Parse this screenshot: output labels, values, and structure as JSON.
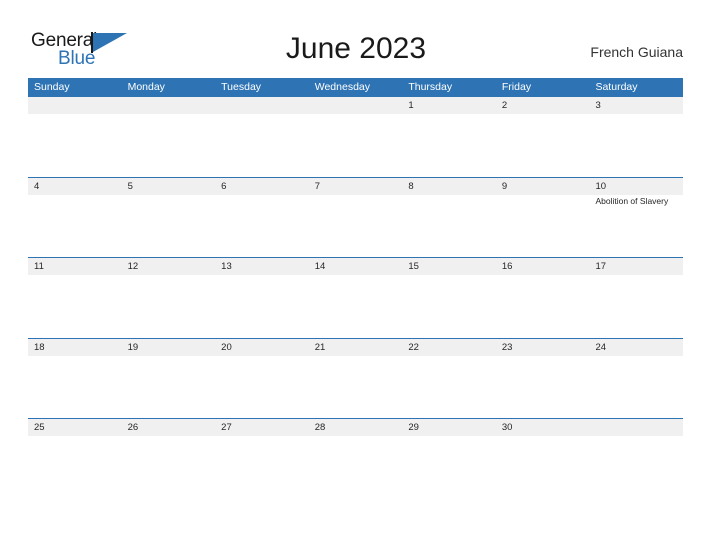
{
  "brand": {
    "name_part1": "General",
    "name_part2": "Blue",
    "flag_icon": "blue-triangle-flag-icon",
    "accent_color": "#2e74b5",
    "text_color": "#1a1a1a"
  },
  "header": {
    "title": "June 2023",
    "location": "French Guiana"
  },
  "calendar": {
    "header_color": "#2e74b5",
    "date_band_color": "#f0f0f0",
    "row_divider_color": "#2e74b5",
    "weekdays": [
      "Sunday",
      "Monday",
      "Tuesday",
      "Wednesday",
      "Thursday",
      "Friday",
      "Saturday"
    ],
    "weeks": [
      {
        "days": [
          {
            "number": "",
            "event": ""
          },
          {
            "number": "",
            "event": ""
          },
          {
            "number": "",
            "event": ""
          },
          {
            "number": "",
            "event": ""
          },
          {
            "number": "1",
            "event": ""
          },
          {
            "number": "2",
            "event": ""
          },
          {
            "number": "3",
            "event": ""
          }
        ]
      },
      {
        "days": [
          {
            "number": "4",
            "event": ""
          },
          {
            "number": "5",
            "event": ""
          },
          {
            "number": "6",
            "event": ""
          },
          {
            "number": "7",
            "event": ""
          },
          {
            "number": "8",
            "event": ""
          },
          {
            "number": "9",
            "event": ""
          },
          {
            "number": "10",
            "event": "Abolition of Slavery"
          }
        ]
      },
      {
        "days": [
          {
            "number": "11",
            "event": ""
          },
          {
            "number": "12",
            "event": ""
          },
          {
            "number": "13",
            "event": ""
          },
          {
            "number": "14",
            "event": ""
          },
          {
            "number": "15",
            "event": ""
          },
          {
            "number": "16",
            "event": ""
          },
          {
            "number": "17",
            "event": ""
          }
        ]
      },
      {
        "days": [
          {
            "number": "18",
            "event": ""
          },
          {
            "number": "19",
            "event": ""
          },
          {
            "number": "20",
            "event": ""
          },
          {
            "number": "21",
            "event": ""
          },
          {
            "number": "22",
            "event": ""
          },
          {
            "number": "23",
            "event": ""
          },
          {
            "number": "24",
            "event": ""
          }
        ]
      },
      {
        "days": [
          {
            "number": "25",
            "event": ""
          },
          {
            "number": "26",
            "event": ""
          },
          {
            "number": "27",
            "event": ""
          },
          {
            "number": "28",
            "event": ""
          },
          {
            "number": "29",
            "event": ""
          },
          {
            "number": "30",
            "event": ""
          },
          {
            "number": "",
            "event": ""
          }
        ]
      }
    ]
  }
}
